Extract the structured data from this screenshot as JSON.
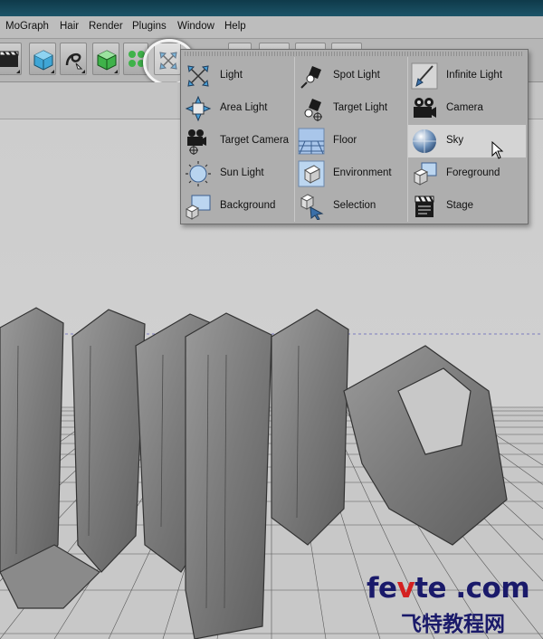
{
  "menubar": {
    "items": [
      "MoGraph",
      "Hair",
      "Render",
      "Plugins",
      "Window",
      "Help"
    ]
  },
  "toolbar": {
    "buttons": [
      "clapper-icon",
      "cube-icon",
      "spline-pen-icon",
      "green-cube-icon",
      "cloner-icon",
      "light-icon",
      "more-icon",
      "record-icon",
      "timeline-icon",
      "extra-icon"
    ]
  },
  "dropdown": {
    "items": [
      {
        "label": "Light",
        "icon": "light-icon"
      },
      {
        "label": "Spot Light",
        "icon": "spot-light-icon"
      },
      {
        "label": "Infinite Light",
        "icon": "infinite-light-icon"
      },
      {
        "label": "Area Light",
        "icon": "area-light-icon"
      },
      {
        "label": "Target Light",
        "icon": "target-light-icon"
      },
      {
        "label": "Camera",
        "icon": "camera-icon"
      },
      {
        "label": "Target Camera",
        "icon": "target-camera-icon"
      },
      {
        "label": "Floor",
        "icon": "floor-icon"
      },
      {
        "label": "Sky",
        "icon": "sky-icon"
      },
      {
        "label": "Sun Light",
        "icon": "sun-light-icon"
      },
      {
        "label": "Environment",
        "icon": "environment-icon"
      },
      {
        "label": "Foreground",
        "icon": "foreground-icon"
      },
      {
        "label": "Background",
        "icon": "background-icon"
      },
      {
        "label": "Selection",
        "icon": "selection-icon"
      },
      {
        "label": "Stage",
        "icon": "stage-icon"
      }
    ],
    "hovered": "Sky"
  },
  "watermark": {
    "line1_a": "fe",
    "line1_v": "v",
    "line1_b": "te .com",
    "line2": "飞特教程网"
  },
  "colors": {
    "titlebar": "#1c5468",
    "menu_bg": "#aeaeae",
    "hover_bg": "#d4d4d4",
    "watermark_blue": "#1a1a6a",
    "watermark_red": "#d42020"
  }
}
